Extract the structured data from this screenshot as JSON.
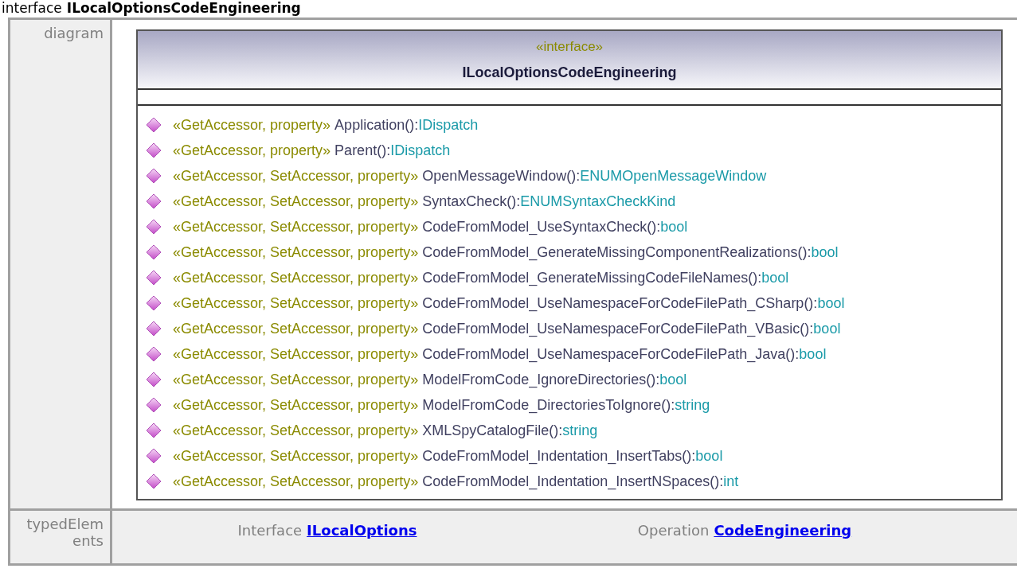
{
  "title": {
    "kind_label": "interface",
    "name": "ILocalOptionsCodeEngineering"
  },
  "diagram_row": {
    "label": "diagram",
    "class_box": {
      "stereotype": "«interface»",
      "name": "ILocalOptionsCodeEngineering",
      "operations": [
        {
          "stereotype": "«GetAccessor, property»",
          "signature": "Application():",
          "type": "IDispatch"
        },
        {
          "stereotype": "«GetAccessor, property»",
          "signature": "Parent():",
          "type": "IDispatch"
        },
        {
          "stereotype": "«GetAccessor, SetAccessor, property»",
          "signature": "OpenMessageWindow():",
          "type": "ENUMOpenMessageWindow"
        },
        {
          "stereotype": "«GetAccessor, SetAccessor, property»",
          "signature": "SyntaxCheck():",
          "type": "ENUMSyntaxCheckKind"
        },
        {
          "stereotype": "«GetAccessor, SetAccessor, property»",
          "signature": "CodeFromModel_UseSyntaxCheck():",
          "type": "bool"
        },
        {
          "stereotype": "«GetAccessor, SetAccessor, property»",
          "signature": "CodeFromModel_GenerateMissingComponentRealizations():",
          "type": "bool"
        },
        {
          "stereotype": "«GetAccessor, SetAccessor, property»",
          "signature": "CodeFromModel_GenerateMissingCodeFileNames():",
          "type": "bool"
        },
        {
          "stereotype": "«GetAccessor, SetAccessor, property»",
          "signature": "CodeFromModel_UseNamespaceForCodeFilePath_CSharp():",
          "type": "bool"
        },
        {
          "stereotype": "«GetAccessor, SetAccessor, property»",
          "signature": "CodeFromModel_UseNamespaceForCodeFilePath_VBasic():",
          "type": "bool"
        },
        {
          "stereotype": "«GetAccessor, SetAccessor, property»",
          "signature": "CodeFromModel_UseNamespaceForCodeFilePath_Java():",
          "type": "bool"
        },
        {
          "stereotype": "«GetAccessor, SetAccessor, property»",
          "signature": "ModelFromCode_IgnoreDirectories():",
          "type": "bool"
        },
        {
          "stereotype": "«GetAccessor, SetAccessor, property»",
          "signature": "ModelFromCode_DirectoriesToIgnore():",
          "type": "string"
        },
        {
          "stereotype": "«GetAccessor, SetAccessor, property»",
          "signature": "XMLSpyCatalogFile():",
          "type": "string"
        },
        {
          "stereotype": "«GetAccessor, SetAccessor, property»",
          "signature": "CodeFromModel_Indentation_InsertTabs():",
          "type": "bool"
        },
        {
          "stereotype": "«GetAccessor, SetAccessor, property»",
          "signature": "CodeFromModel_Indentation_InsertNSpaces():",
          "type": "int"
        }
      ]
    }
  },
  "typed_elements_row": {
    "label": "typedElem ents",
    "entries": [
      {
        "kind_label": "Interface",
        "link": "ILocalOptions"
      },
      {
        "kind_label": "Operation",
        "link": "CodeEngineering"
      }
    ]
  }
}
